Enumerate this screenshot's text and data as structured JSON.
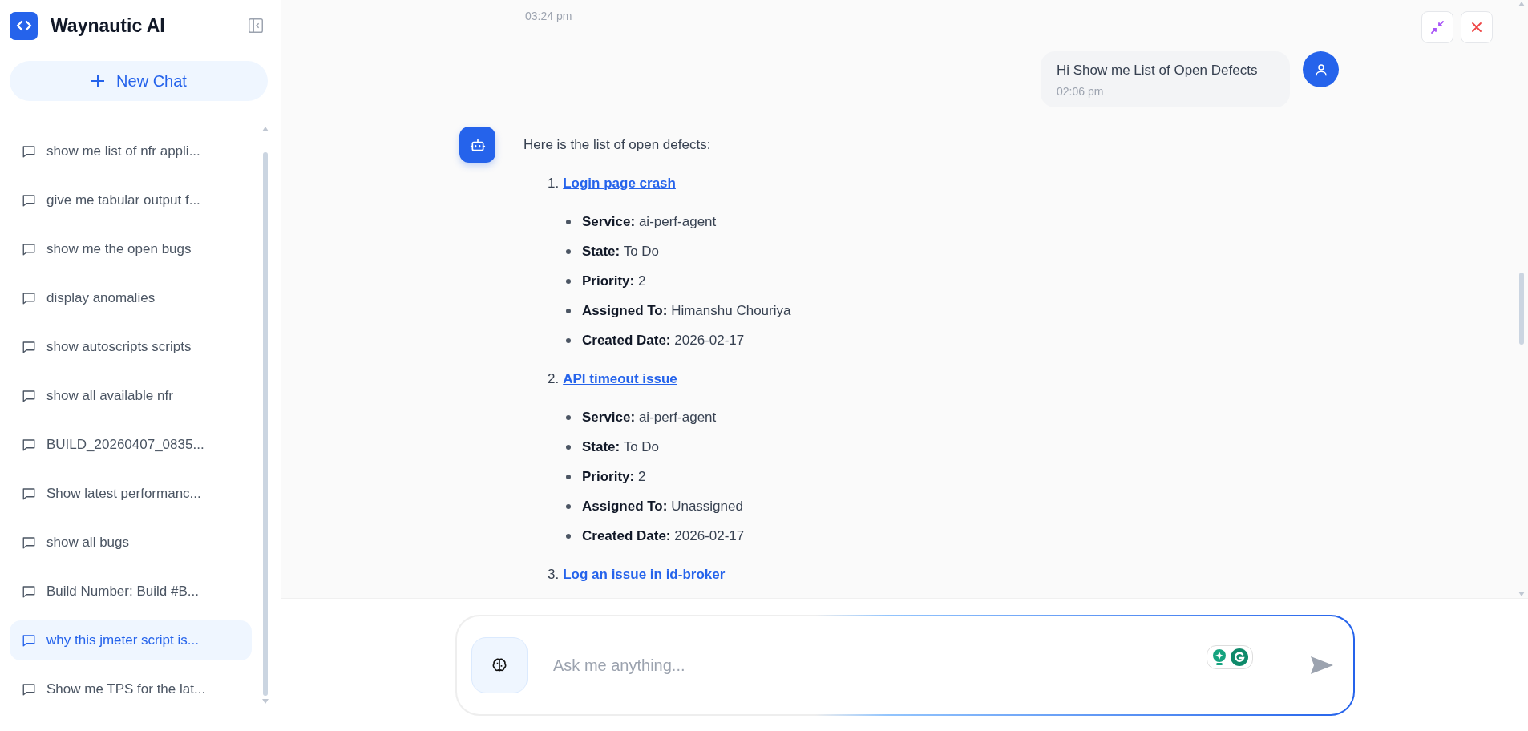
{
  "app": {
    "title": "Waynautic AI"
  },
  "sidebar": {
    "new_chat": "New Chat",
    "chats": [
      {
        "label": "show me list of nfr appli...",
        "selected": false
      },
      {
        "label": "give me tabular output f...",
        "selected": false
      },
      {
        "label": "show me the open bugs",
        "selected": false
      },
      {
        "label": "display anomalies",
        "selected": false
      },
      {
        "label": "show autoscripts scripts",
        "selected": false
      },
      {
        "label": "show all available nfr",
        "selected": false
      },
      {
        "label": "BUILD_20260407_0835...",
        "selected": false
      },
      {
        "label": "Show latest performanc...",
        "selected": false
      },
      {
        "label": "show all bugs",
        "selected": false
      },
      {
        "label": "Build Number: Build #B...",
        "selected": false
      },
      {
        "label": "why this jmeter script is...",
        "selected": true
      },
      {
        "label": "Show me TPS for the lat...",
        "selected": false
      }
    ]
  },
  "chat": {
    "earlier_time": "03:24 pm",
    "messages": [
      {
        "kind": "user",
        "text": "Hi Show me List of Open Defects",
        "time": "02:06 pm"
      },
      {
        "kind": "bot",
        "intro": "Here is the list of open defects:",
        "defects": [
          {
            "number": "1.",
            "title": "Login page crash",
            "fields": [
              "**Service:** ai-perf-agent",
              "**State:** To Do",
              "**Priority:** 2",
              "**Assigned To:** Himanshu Chouriya",
              "**Created Date:** 2026-02-17"
            ]
          },
          {
            "number": "2.",
            "title": "API timeout issue",
            "fields": [
              "**Service:** ai-perf-agent",
              "**State:** To Do",
              "**Priority:** 2",
              "**Assigned To:** Unassigned",
              "**Created Date:** 2026-02-17"
            ]
          },
          {
            "number": "3.",
            "title": "Log an issue in id-broker"
          }
        ]
      }
    ]
  },
  "composer": {
    "placeholder": "Ask me anything..."
  }
}
